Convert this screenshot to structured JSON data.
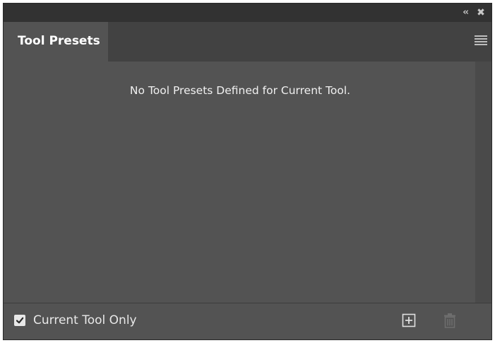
{
  "panel": {
    "tab_label": "Tool Presets",
    "empty_message": "No Tool Presets Defined for Current Tool.",
    "current_tool_only_label": "Current Tool Only",
    "current_tool_only_checked": true
  },
  "titlebar": {
    "collapse_glyph": "‹‹",
    "close_glyph": "✖"
  },
  "icons": {
    "collapse": "double-chevron-left-icon",
    "close": "close-icon",
    "menu": "hamburger-menu-icon",
    "new_preset": "new-preset-plus-icon",
    "delete": "trash-icon"
  },
  "colors": {
    "panel_bg": "#535353",
    "titlebar_bg": "#323232",
    "tabbar_bg": "#424242",
    "text": "#f0f0f0",
    "disabled_icon": "#6e6e6e"
  }
}
